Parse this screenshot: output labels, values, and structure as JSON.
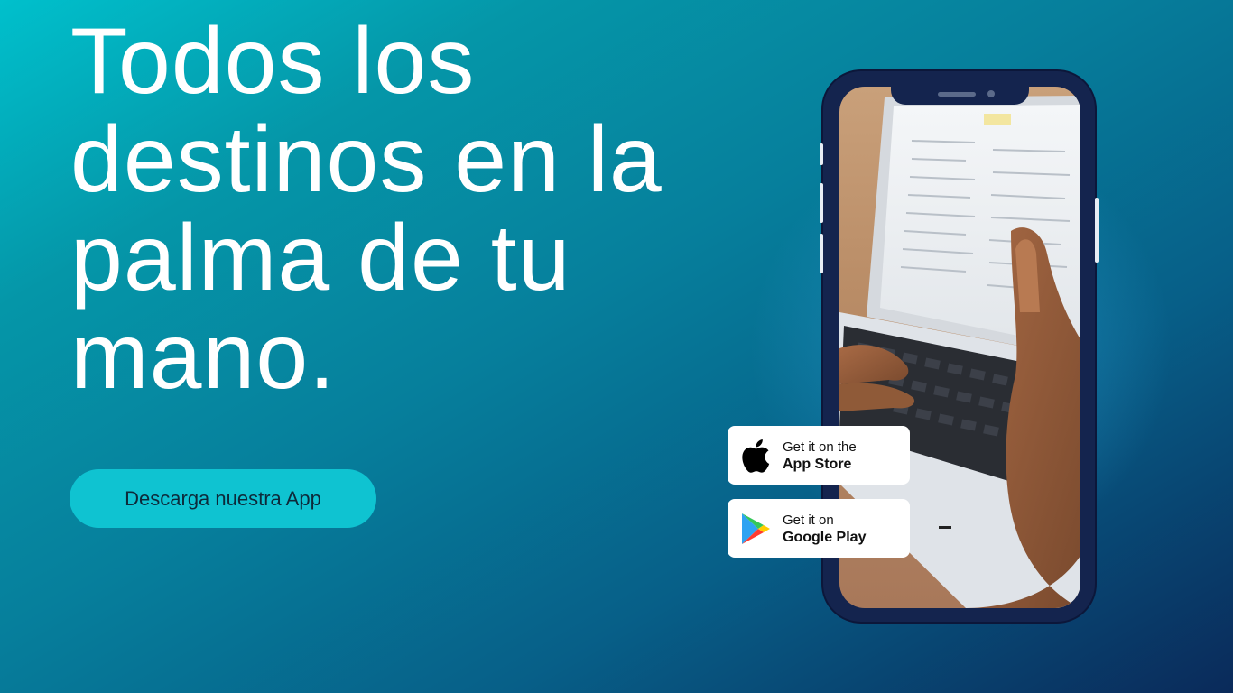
{
  "hero": {
    "headline_lines": [
      "Todos los",
      "destinos en la",
      "palma de tu",
      "mano."
    ],
    "cta_label": "Descarga nuestra App"
  },
  "badges": {
    "app_store": {
      "line1": "Get it on the",
      "line2": "App Store",
      "icon": "apple-icon"
    },
    "google_play": {
      "line1": "Get it on",
      "line2": "Google Play",
      "icon": "google-play-icon"
    }
  },
  "colors": {
    "background_start": "#00c0cc",
    "background_end": "#0a2a5a",
    "cta_background": "#0fc3d1",
    "phone_frame": "#14244e",
    "headline": "#ffffff"
  }
}
